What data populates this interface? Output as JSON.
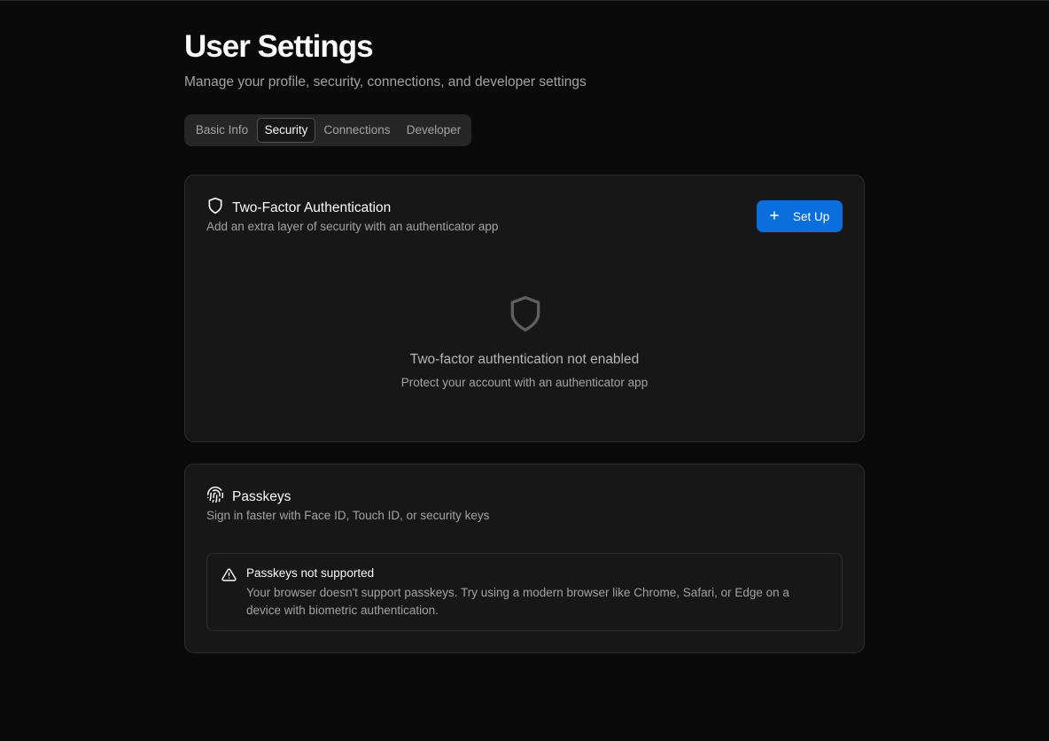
{
  "page": {
    "title": "User Settings",
    "subtitle": "Manage your profile, security, connections, and developer settings"
  },
  "tabs": [
    {
      "label": "Basic Info",
      "active": false
    },
    {
      "label": "Security",
      "active": true
    },
    {
      "label": "Connections",
      "active": false
    },
    {
      "label": "Developer",
      "active": false
    }
  ],
  "two_factor": {
    "icon": "shield-icon",
    "title": "Two-Factor Authentication",
    "description": "Add an extra layer of security with an authenticator app",
    "button_label": "Set Up",
    "button_icon": "plus-icon",
    "empty_icon": "shield-icon",
    "empty_title": "Two-factor authentication not enabled",
    "empty_subtitle": "Protect your account with an authenticator app"
  },
  "passkeys": {
    "icon": "fingerprint-icon",
    "title": "Passkeys",
    "description": "Sign in faster with Face ID, Touch ID, or security keys",
    "alert": {
      "icon": "warning-triangle-icon",
      "title": "Passkeys not supported",
      "description": "Your browser doesn't support passkeys. Try using a modern browser like Chrome, Safari, or Edge on a device with biometric authentication."
    }
  },
  "colors": {
    "background": "#0a0a0a",
    "card": "#171717",
    "accent": "#0a6fdc",
    "muted_text": "#a3a3a3"
  }
}
